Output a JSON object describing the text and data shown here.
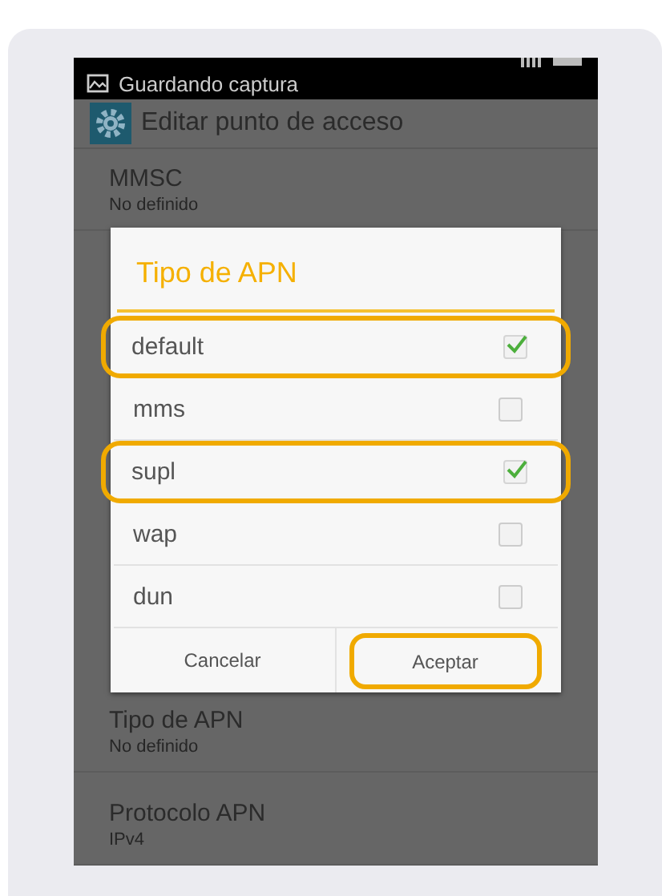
{
  "status_bar": {
    "notification": "Guardando captura"
  },
  "action_bar": {
    "title": "Editar punto de acceso"
  },
  "settings_top": [
    {
      "label": "MMSC",
      "value": "No definido"
    }
  ],
  "settings_bottom": [
    {
      "label": "Tipo de APN",
      "value": "No definido"
    },
    {
      "label": "Protocolo APN",
      "value": "IPv4"
    }
  ],
  "dialog": {
    "title": "Tipo de APN",
    "options": [
      {
        "label": "default",
        "checked": true,
        "highlighted": true
      },
      {
        "label": "mms",
        "checked": false,
        "highlighted": false
      },
      {
        "label": "supl",
        "checked": true,
        "highlighted": true
      },
      {
        "label": "wap",
        "checked": false,
        "highlighted": false
      },
      {
        "label": "dun",
        "checked": false,
        "highlighted": false
      }
    ],
    "buttons": [
      {
        "label": "Cancelar",
        "highlighted": false
      },
      {
        "label": "Aceptar",
        "highlighted": true
      }
    ]
  }
}
